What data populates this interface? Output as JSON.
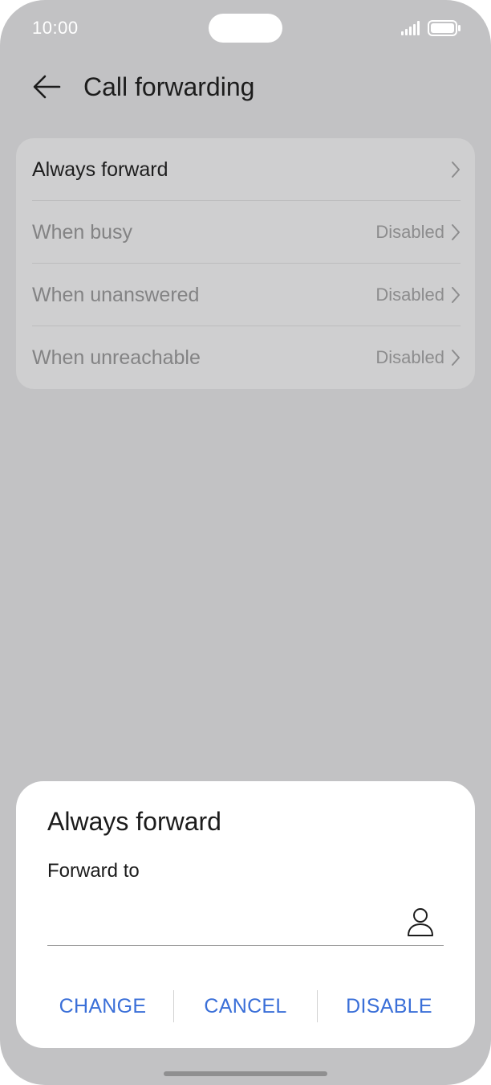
{
  "status_bar": {
    "time": "10:00"
  },
  "header": {
    "title": "Call forwarding"
  },
  "list": {
    "items": [
      {
        "label": "Always forward",
        "value": ""
      },
      {
        "label": "When busy",
        "value": "Disabled"
      },
      {
        "label": "When unanswered",
        "value": "Disabled"
      },
      {
        "label": "When unreachable",
        "value": "Disabled"
      }
    ]
  },
  "dialog": {
    "title": "Always forward",
    "field_label": "Forward to",
    "field_value": "",
    "actions": {
      "change": "CHANGE",
      "cancel": "CANCEL",
      "disable": "DISABLE"
    }
  },
  "colors": {
    "accent": "#3a6fd8",
    "scrim": "#c2c2c4"
  }
}
